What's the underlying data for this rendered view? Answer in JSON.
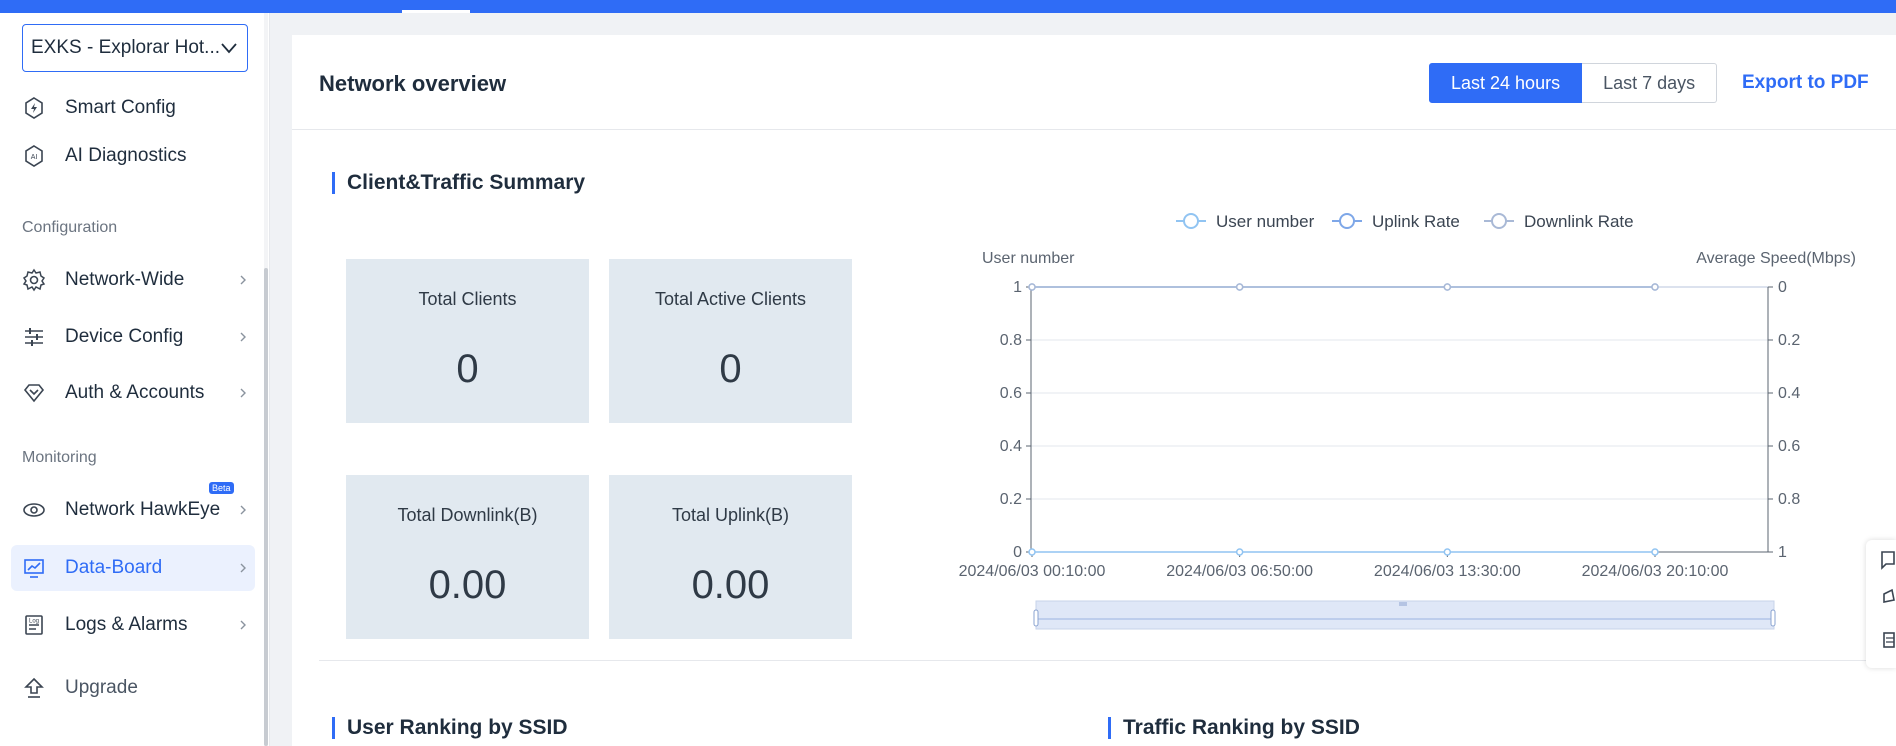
{
  "site_select": {
    "label": "EXKS - Explorar Hot..."
  },
  "sidebar": {
    "items": [
      {
        "label": "Smart Config",
        "icon": "smart-config-icon"
      },
      {
        "label": "AI Diagnostics",
        "icon": "ai-diagnostics-icon"
      },
      {
        "label": "Network-Wide",
        "icon": "gear-icon"
      },
      {
        "label": "Device Config",
        "icon": "sliders-icon"
      },
      {
        "label": "Auth & Accounts",
        "icon": "diamond-icon"
      },
      {
        "label": "Network HawkEye",
        "icon": "eye-icon",
        "badge": "Beta"
      },
      {
        "label": "Data-Board",
        "icon": "dashboard-icon"
      },
      {
        "label": "Logs & Alarms",
        "icon": "logs-icon"
      },
      {
        "label": "Upgrade",
        "icon": "upgrade-icon"
      }
    ],
    "sections": {
      "configuration": "Configuration",
      "monitoring": "Monitoring"
    },
    "active": "Data-Board"
  },
  "header": {
    "title": "Network overview",
    "range_options": [
      "Last 24 hours",
      "Last 7 days"
    ],
    "selected_range": "Last 24 hours",
    "export": "Export to PDF"
  },
  "summary": {
    "title": "Client&Traffic Summary",
    "cards": [
      {
        "label": "Total Clients",
        "value": "0"
      },
      {
        "label": "Total Active Clients",
        "value": "0"
      },
      {
        "label": "Total Downlink(B)",
        "value": "0.00"
      },
      {
        "label": "Total Uplink(B)",
        "value": "0.00"
      }
    ]
  },
  "rankings": {
    "user_title": "User Ranking by SSID",
    "traffic_title": "Traffic Ranking by SSID"
  },
  "colors": {
    "accent": "#2f6cf6",
    "card_bg": "#e1e9f0",
    "series_user": "#91c4f2",
    "series_uplink": "#7ea7e8",
    "series_downlink": "#a9b9d6"
  },
  "chart_data": {
    "type": "line",
    "legend": [
      "User number",
      "Uplink Rate",
      "Downlink Rate"
    ],
    "legend_position": "top-center",
    "left_axis_label": "User number",
    "right_axis_label": "Average Speed(Mbps)",
    "left_ticks": [
      "0",
      "0.2",
      "0.4",
      "0.6",
      "0.8",
      "1"
    ],
    "right_ticks": [
      "1",
      "0.8",
      "0.6",
      "0.4",
      "0.2",
      "0"
    ],
    "x_ticks": [
      "2024/06/03 00:10:00",
      "2024/06/03 06:50:00",
      "2024/06/03 13:30:00",
      "2024/06/03 20:10:00"
    ],
    "ylim_left": [
      0,
      1
    ],
    "ylim_right": [
      1,
      0
    ],
    "grid": true,
    "series": [
      {
        "name": "User number",
        "values": [
          0,
          0,
          0,
          0
        ]
      },
      {
        "name": "Uplink Rate",
        "values": [
          0,
          0,
          0,
          0
        ]
      },
      {
        "name": "Downlink Rate",
        "values": [
          0,
          0,
          0,
          0
        ]
      }
    ]
  }
}
